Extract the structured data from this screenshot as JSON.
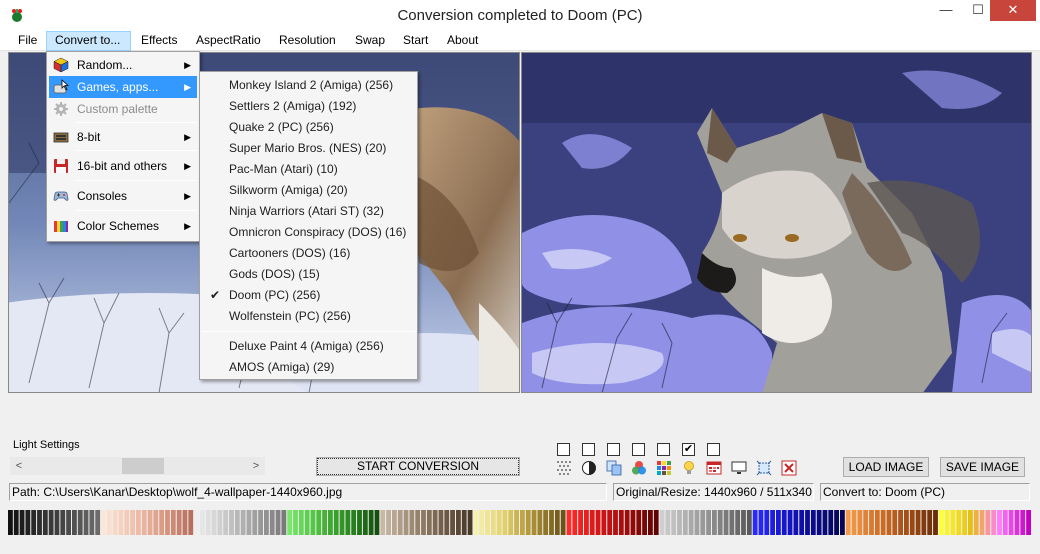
{
  "window": {
    "title": "Conversion completed to Doom (PC)",
    "min_glyph": "—",
    "max_glyph": "☐",
    "close_glyph": "✕"
  },
  "menubar": {
    "items": [
      "File",
      "Convert to...",
      "Effects",
      "AspectRatio",
      "Resolution",
      "Swap",
      "Start",
      "About"
    ],
    "active": "Convert to..."
  },
  "convert_menu": {
    "items": [
      {
        "label": "Random...",
        "icon": "rubik-cube-icon",
        "submenu": true
      },
      {
        "label": "Games, apps...",
        "icon": "game-pointer-icon",
        "submenu": true,
        "highlighted": true
      },
      {
        "label": "Custom palette",
        "icon": "gear-icon",
        "disabled": true
      },
      {
        "label": "8-bit",
        "icon": "computer-8bit-icon",
        "submenu": true
      },
      {
        "label": "16-bit and others",
        "icon": "floppy-disk-icon",
        "submenu": true
      },
      {
        "label": "Consoles",
        "icon": "gamepad-icon",
        "submenu": true
      },
      {
        "label": "Color Schemes",
        "icon": "color-swatches-icon",
        "submenu": true
      }
    ]
  },
  "games_submenu": {
    "items": [
      {
        "label": "Monkey Island 2 (Amiga) (256)"
      },
      {
        "label": "Settlers 2 (Amiga) (192)"
      },
      {
        "label": "Quake 2 (PC) (256)"
      },
      {
        "label": "Super Mario Bros. (NES) (20)"
      },
      {
        "label": "Pac-Man (Atari) (10)"
      },
      {
        "label": "Silkworm (Amiga) (20)"
      },
      {
        "label": "Ninja Warriors (Atari ST) (32)"
      },
      {
        "label": "Omnicron Conspiracy (DOS) (16)"
      },
      {
        "label": "Cartooners (DOS) (16)"
      },
      {
        "label": "Gods (DOS) (15)"
      },
      {
        "label": "Doom (PC) (256)",
        "checked": true
      },
      {
        "label": "Wolfenstein (PC) (256)"
      },
      {
        "label": "Deluxe Paint 4 (Amiga) (256)"
      },
      {
        "label": "AMOS (Amiga) (29)"
      }
    ],
    "check_glyph": "✔"
  },
  "controls": {
    "light_settings_label": "Light Settings",
    "scroll_left": "<",
    "scroll_right": ">",
    "slider_value": 0.5,
    "start_button": "START CONVERSION",
    "checkboxes": [
      false,
      false,
      false,
      false,
      false,
      true,
      false
    ],
    "check_glyph": "✔",
    "load_button": "LOAD IMAGE",
    "save_button": "SAVE IMAGE",
    "tool_icons": [
      "dither-icon",
      "contrast-icon",
      "copy-icon",
      "rgb-circles-icon",
      "color-grid-icon",
      "lightbulb-icon",
      "palette-window-icon",
      "monitor-icon",
      "crop-icon",
      "close-image-icon"
    ]
  },
  "status": {
    "path": "Path:  C:\\Users\\Kanar\\Desktop\\wolf_4-wallpaper-1440x960.jpg",
    "resolution": "Original/Resize:  1440x960 / 511x340",
    "convert_to": "Convert to:  Doom (PC)"
  },
  "palette": {
    "groups": [
      [
        "#111111",
        "#2e2e2e",
        "#4a4a4a",
        "#6b6b6b"
      ],
      [
        "#fbe6d8",
        "#f1c3ae",
        "#dc9c86",
        "#b96f5e"
      ],
      [
        "#eeeeee",
        "#c8c8c8",
        "#a0a0a0",
        "#7a7a7a"
      ],
      [
        "#78e86b",
        "#4dbd3e",
        "#2c8b22",
        "#165010"
      ],
      [
        "#c9b8a3",
        "#9e8b75",
        "#735f4a",
        "#4a3a2a"
      ],
      [
        "#f8f2b0",
        "#e2cf68",
        "#a88d34",
        "#6a5418"
      ],
      [
        "#ff2a2a",
        "#d61717",
        "#9e0b0b",
        "#5e0404"
      ],
      [
        "#cfcfcf",
        "#a9a9a9",
        "#828282",
        "#5a5a5a"
      ],
      [
        "#2a2aff",
        "#1616cc",
        "#0b0b8f",
        "#050552"
      ],
      [
        "#f39b4a",
        "#d4722a",
        "#a44f16",
        "#6c2e08"
      ],
      [
        "#ffff36",
        "#e6c015",
        "#ff7cf7",
        "#c400c4"
      ]
    ]
  },
  "colors": {
    "menu_highlight": "#3399ff",
    "menubar_active": "#cce8ff",
    "close_button": "#c7453b"
  }
}
